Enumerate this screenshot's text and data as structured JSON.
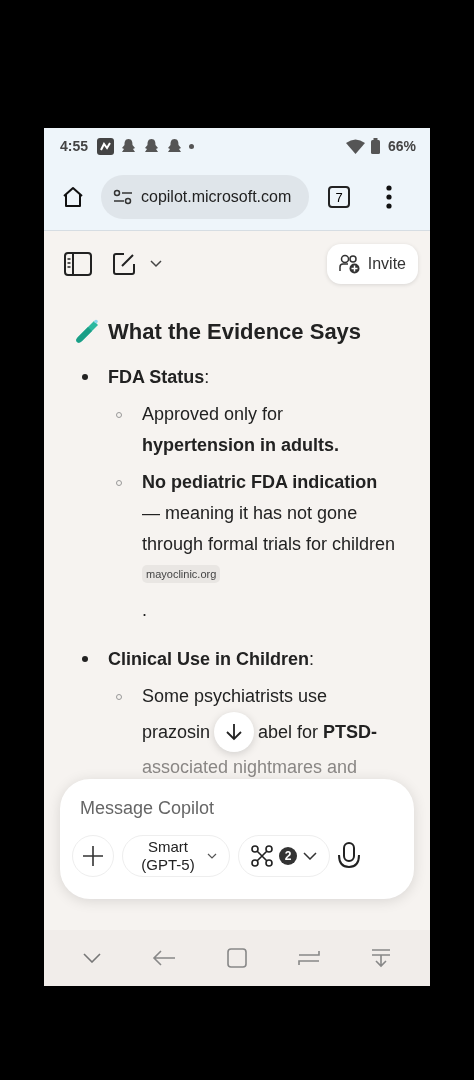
{
  "status_bar": {
    "time": "4:55",
    "battery": "66%"
  },
  "browser": {
    "url": "copilot.microsoft.com",
    "tab_count": "7"
  },
  "header": {
    "invite_label": "Invite"
  },
  "content": {
    "heading": "What the Evidence Says",
    "sections": [
      {
        "title": "**FDA Status**:",
        "items": [
          {
            "text": "Approved only for **hypertension in adults.**"
          },
          {
            "text": "**No pediatric FDA indication** — meaning it has not gone through formal trials for children",
            "source": "mayoclinic.org",
            "trailing": "."
          }
        ]
      },
      {
        "title": "**Clinical Use in Children**:",
        "items": [
          {
            "kind": "covered",
            "first": "Some psychiatrists use",
            "before_button": "prazosin",
            "after_button": "abel for **PTSD-**",
            "last": "associated nightmares and"
          }
        ]
      }
    ]
  },
  "composer": {
    "placeholder": "Message Copilot",
    "model": "Smart (GPT-5)",
    "tools_count": "2"
  }
}
